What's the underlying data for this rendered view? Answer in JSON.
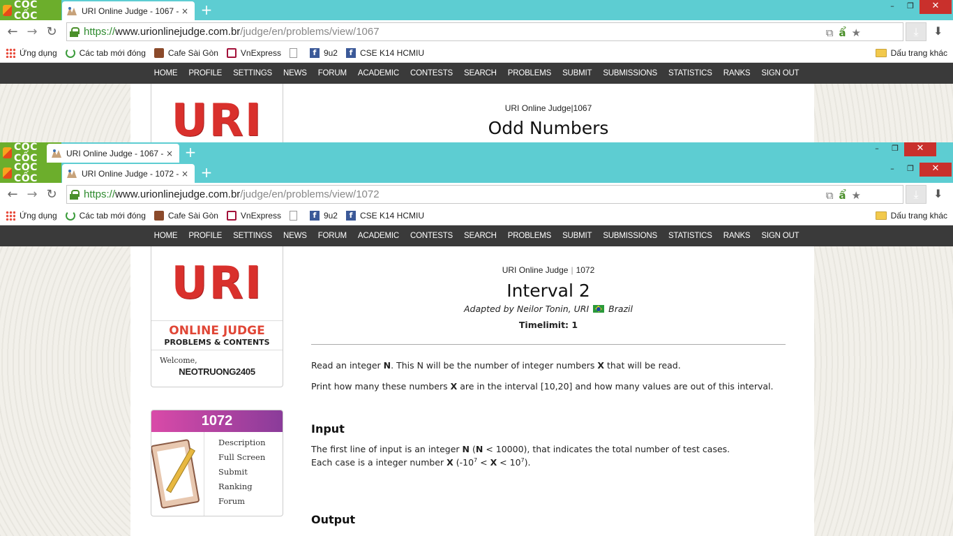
{
  "browser": {
    "logo_text": "CỐC CỐC",
    "new_tab_symbol": "+",
    "close_symbol": "×",
    "window_controls": {
      "minimize": "–",
      "maximize": "❐",
      "close": "✕"
    }
  },
  "windows": {
    "back": {
      "tab_title": "URI Online Judge - 1067 -",
      "url": {
        "scheme": "https://",
        "host": "www.urionlinejudge.com.br",
        "path": "/judge/en/problems/view/1067"
      },
      "crumb_site": "URI Online Judge",
      "crumb_id": "1067",
      "problem_title": "Odd Numbers"
    },
    "mid": {
      "tab_title": "URI Online Judge - 1067 -"
    },
    "front": {
      "tab_title": "URI Online Judge - 1072 -",
      "url": {
        "scheme": "https://",
        "host": "www.urionlinejudge.com.br",
        "path": "/judge/en/problems/view/1072"
      }
    }
  },
  "bookmarks": [
    {
      "label": "Ứng dụng",
      "icon": "apps-grid-icon"
    },
    {
      "label": "Các tab mới đóng",
      "icon": "recent-tabs-icon"
    },
    {
      "label": "Cafe Sài Gòn",
      "icon": "cafe-icon"
    },
    {
      "label": "VnExpress",
      "icon": "vnexpress-icon"
    },
    {
      "label": "",
      "icon": "page-icon"
    },
    {
      "label": "9u2",
      "icon": "facebook-icon"
    },
    {
      "label": "CSE K14 HCMIU",
      "icon": "facebook-icon"
    }
  ],
  "bookmarks_other": "Dấu trang khác",
  "site_nav": [
    "HOME",
    "PROFILE",
    "SETTINGS",
    "NEWS",
    "FORUM",
    "ACADEMIC",
    "CONTESTS",
    "SEARCH",
    "PROBLEMS",
    "SUBMIT",
    "SUBMISSIONS",
    "STATISTICS",
    "RANKS",
    "SIGN OUT"
  ],
  "sidebar": {
    "logo": "URI",
    "oj_title": "ONLINE JUDGE",
    "oj_subtitle": "PROBLEMS & CONTENTS",
    "welcome_label": "Welcome,",
    "username": "NEOTRUONG2405",
    "problem_id": "1072",
    "problem_links": [
      "Description",
      "Full Screen",
      "Submit",
      "Ranking",
      "Forum"
    ]
  },
  "problem": {
    "crumb_site": "URI Online Judge",
    "crumb_id": "1072",
    "title": "Interval 2",
    "author_prefix": "Adapted by Neilor Tonin, URI",
    "author_country": "Brazil",
    "timelimit": "Timelimit: 1",
    "desc": {
      "p1_a": "Read an integer ",
      "p1_b": "N",
      "p1_c": ". This N will be the number of integer numbers ",
      "p1_d": "X",
      "p1_e": " that will be read.",
      "p2_a": "Print how many these numbers ",
      "p2_b": "X",
      "p2_c": " are in the interval [10,20] and how many values are out of this interval."
    },
    "input_heading": "Input",
    "input": {
      "l1_a": "The first line of input is an integer ",
      "l1_b": "N",
      "l1_c": " (",
      "l1_d": "N",
      "l1_e": " < 10000), that indicates the total number of test cases.",
      "l2_a": "Each case is a integer number ",
      "l2_b": "X",
      "l2_c": " (-10",
      "l2_exp1": "7",
      "l2_d": " < ",
      "l2_e": "X",
      "l2_f": " < 10",
      "l2_exp2": "7",
      "l2_g": ")."
    },
    "output_heading": "Output"
  }
}
